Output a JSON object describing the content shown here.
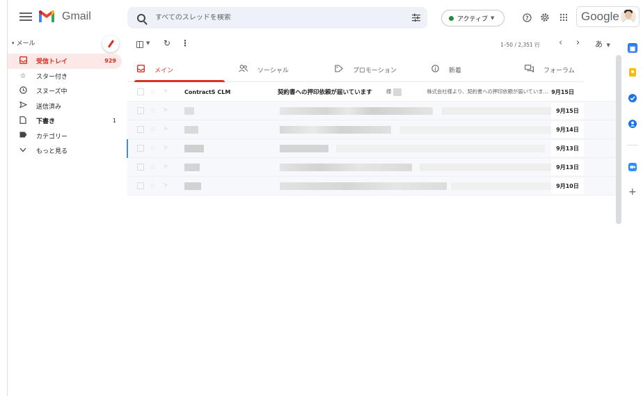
{
  "app": {
    "name": "Gmail",
    "search_placeholder": "すべてのスレッドを検索",
    "status_label": "アクティブ",
    "google_label": "Google"
  },
  "sidebar": {
    "section_label": "メール",
    "items": [
      {
        "icon": "inbox-icon",
        "label": "受信トレイ",
        "count": "929",
        "active": true
      },
      {
        "icon": "star-icon",
        "label": "スター付き",
        "count": ""
      },
      {
        "icon": "clock-icon",
        "label": "スヌーズ中",
        "count": ""
      },
      {
        "icon": "send-icon",
        "label": "送信済み",
        "count": ""
      },
      {
        "icon": "draft-icon",
        "label": "下書き",
        "count": "1"
      },
      {
        "icon": "label-icon",
        "label": "カテゴリー",
        "count": ""
      },
      {
        "icon": "chevron-down-icon",
        "label": "もっと見る",
        "count": ""
      }
    ]
  },
  "toolbar": {
    "page_range": "1–50 / 2,351 行",
    "input_tool": "あ"
  },
  "tabs": [
    {
      "icon": "inbox-tab-icon",
      "label": "メイン",
      "active": true
    },
    {
      "icon": "people-icon",
      "label": "ソーシャル"
    },
    {
      "icon": "tag-icon",
      "label": "プロモーション"
    },
    {
      "icon": "info-icon",
      "label": "新着"
    },
    {
      "icon": "forum-icon",
      "label": "フォーラム"
    }
  ],
  "emails": [
    {
      "sender": "ContractS CLM",
      "subject": "契約書への押印依頼が届いています",
      "snippet": "様　　　　　　　株式会社様より、契約書への押印依頼が届いていま…",
      "date": "9月15日"
    },
    {
      "sender": "",
      "subject": "",
      "snippet": "",
      "date": "9月15日"
    },
    {
      "sender": "",
      "subject": "",
      "snippet": "",
      "date": "9月14日"
    },
    {
      "sender": "",
      "subject": "",
      "snippet": "",
      "date": "9月13日"
    },
    {
      "sender": "",
      "subject": "",
      "snippet": "",
      "date": "9月13日"
    },
    {
      "sender": "",
      "subject": "",
      "snippet": "",
      "date": "9月10日"
    }
  ],
  "colors": {
    "accent_red": "#d93025",
    "active_green": "#1e8e3e",
    "search_bg": "#eef2f8"
  }
}
